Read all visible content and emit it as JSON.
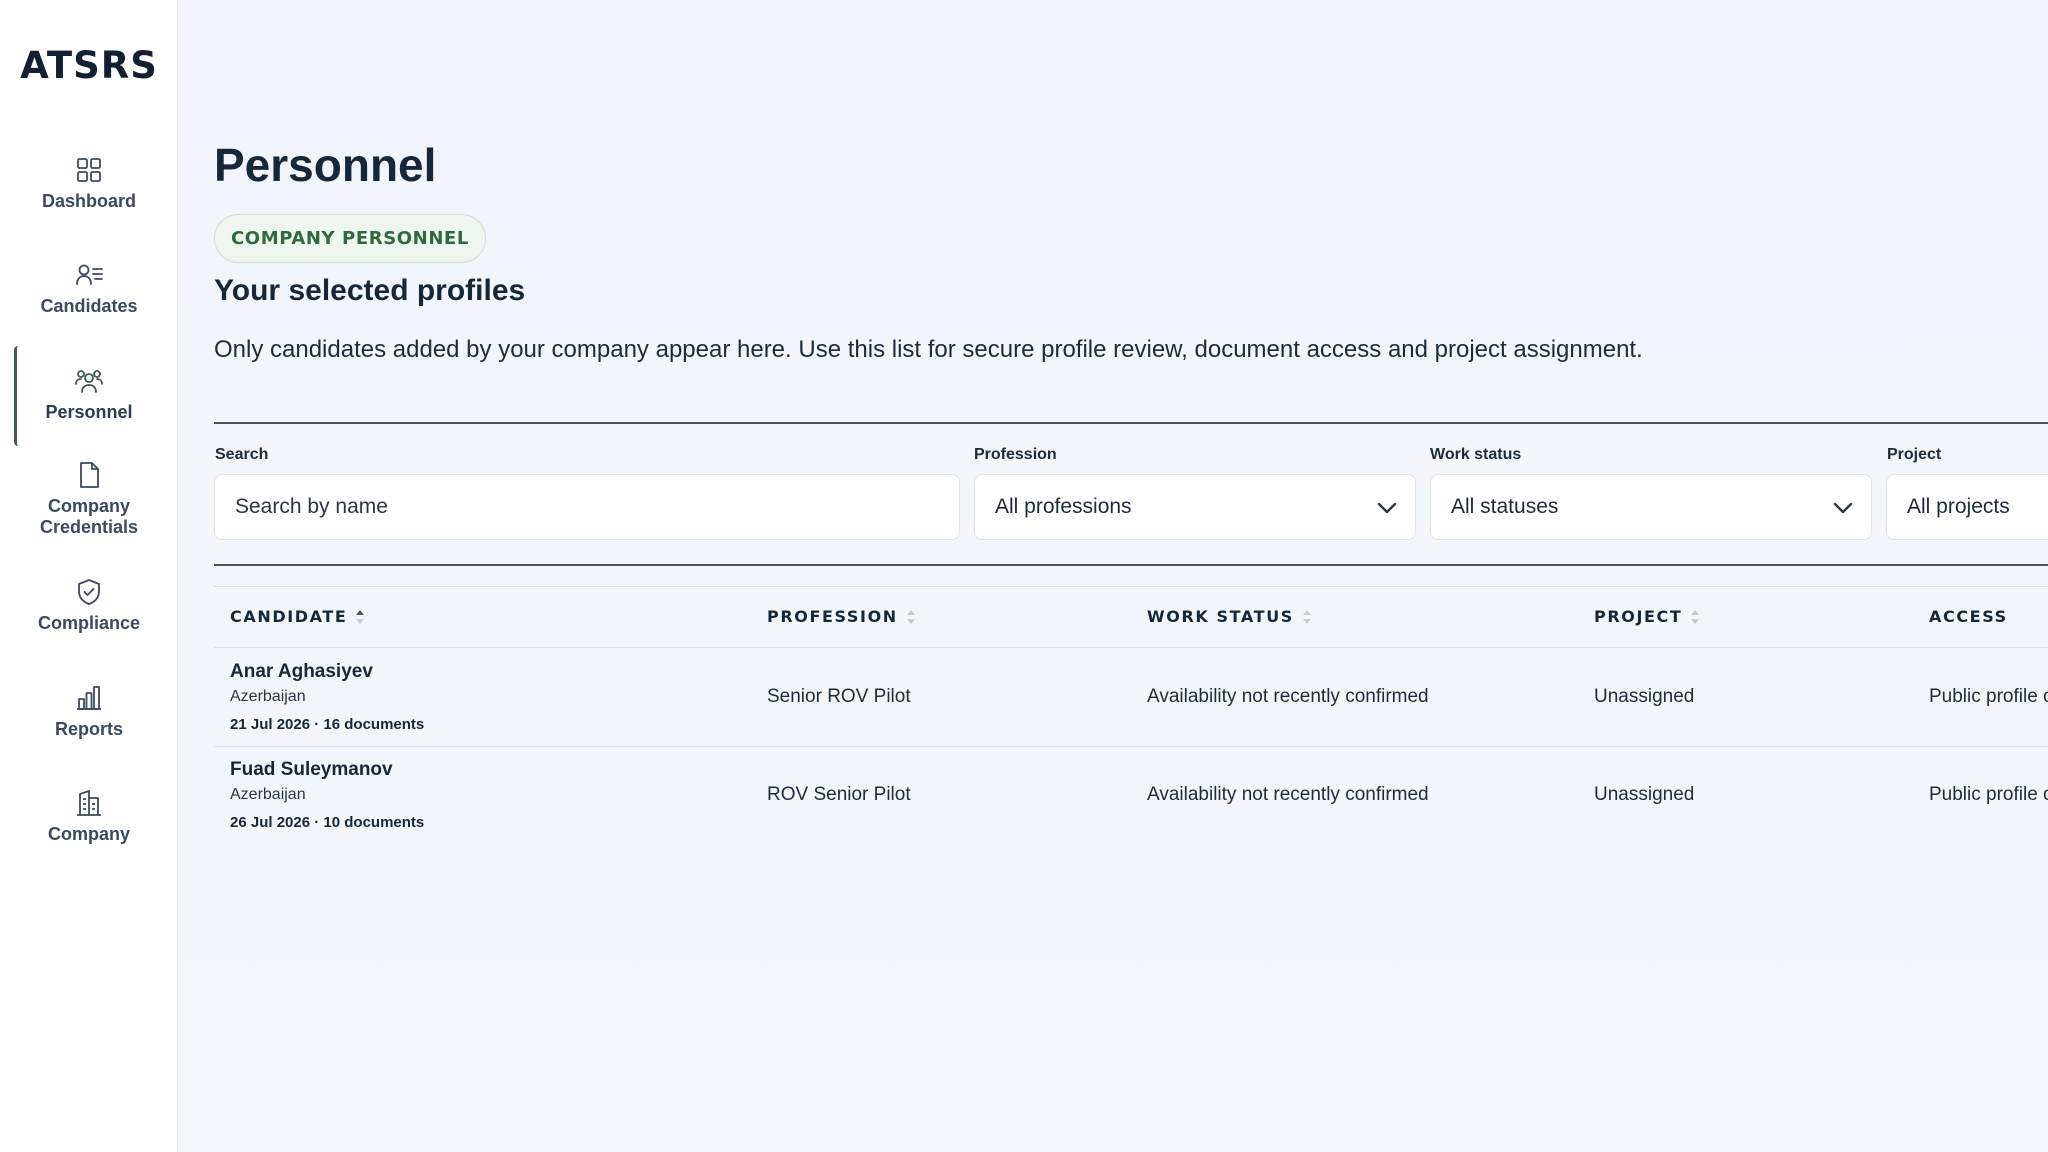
{
  "brand": "ATSRS",
  "nav": {
    "dashboard": "Dashboard",
    "candidates": "Candidates",
    "personnel": "Personnel",
    "credentials": "Company Credentials",
    "compliance": "Compliance",
    "reports": "Reports",
    "company": "Company"
  },
  "page": {
    "title": "Personnel",
    "badge": "COMPANY PERSONNEL",
    "section_title": "Your selected profiles",
    "description": "Only candidates added by your company appear here. Use this list for secure profile review, document access and project assignment."
  },
  "filters": {
    "search_label": "Search",
    "search_placeholder": "Search by name",
    "profession_label": "Profession",
    "profession_value": "All professions",
    "status_label": "Work status",
    "status_value": "All statuses",
    "project_label": "Project",
    "project_value": "All projects"
  },
  "table": {
    "headers": {
      "candidate": "CANDIDATE",
      "profession": "PROFESSION",
      "work_status": "WORK STATUS",
      "project": "PROJECT",
      "access": "ACCESS"
    },
    "rows": [
      {
        "name": "Anar Aghasiyev",
        "country": "Azerbaijan",
        "meta": "21 Jul 2026 · 16 documents",
        "profession": "Senior ROV Pilot",
        "status": "Availability not recently confirmed",
        "project": "Unassigned",
        "access": "Public profile o"
      },
      {
        "name": "Fuad Suleymanov",
        "country": "Azerbaijan",
        "meta": "26 Jul 2026 · 10 documents",
        "profession": "ROV Senior Pilot",
        "status": "Availability not recently confirmed",
        "project": "Unassigned",
        "access": "Public profile o"
      }
    ]
  },
  "colors": {
    "accent": "#3f5c52",
    "badge_text": "#2f6a3d",
    "badge_bg": "#eef6ef",
    "text_dark": "#16273a"
  }
}
